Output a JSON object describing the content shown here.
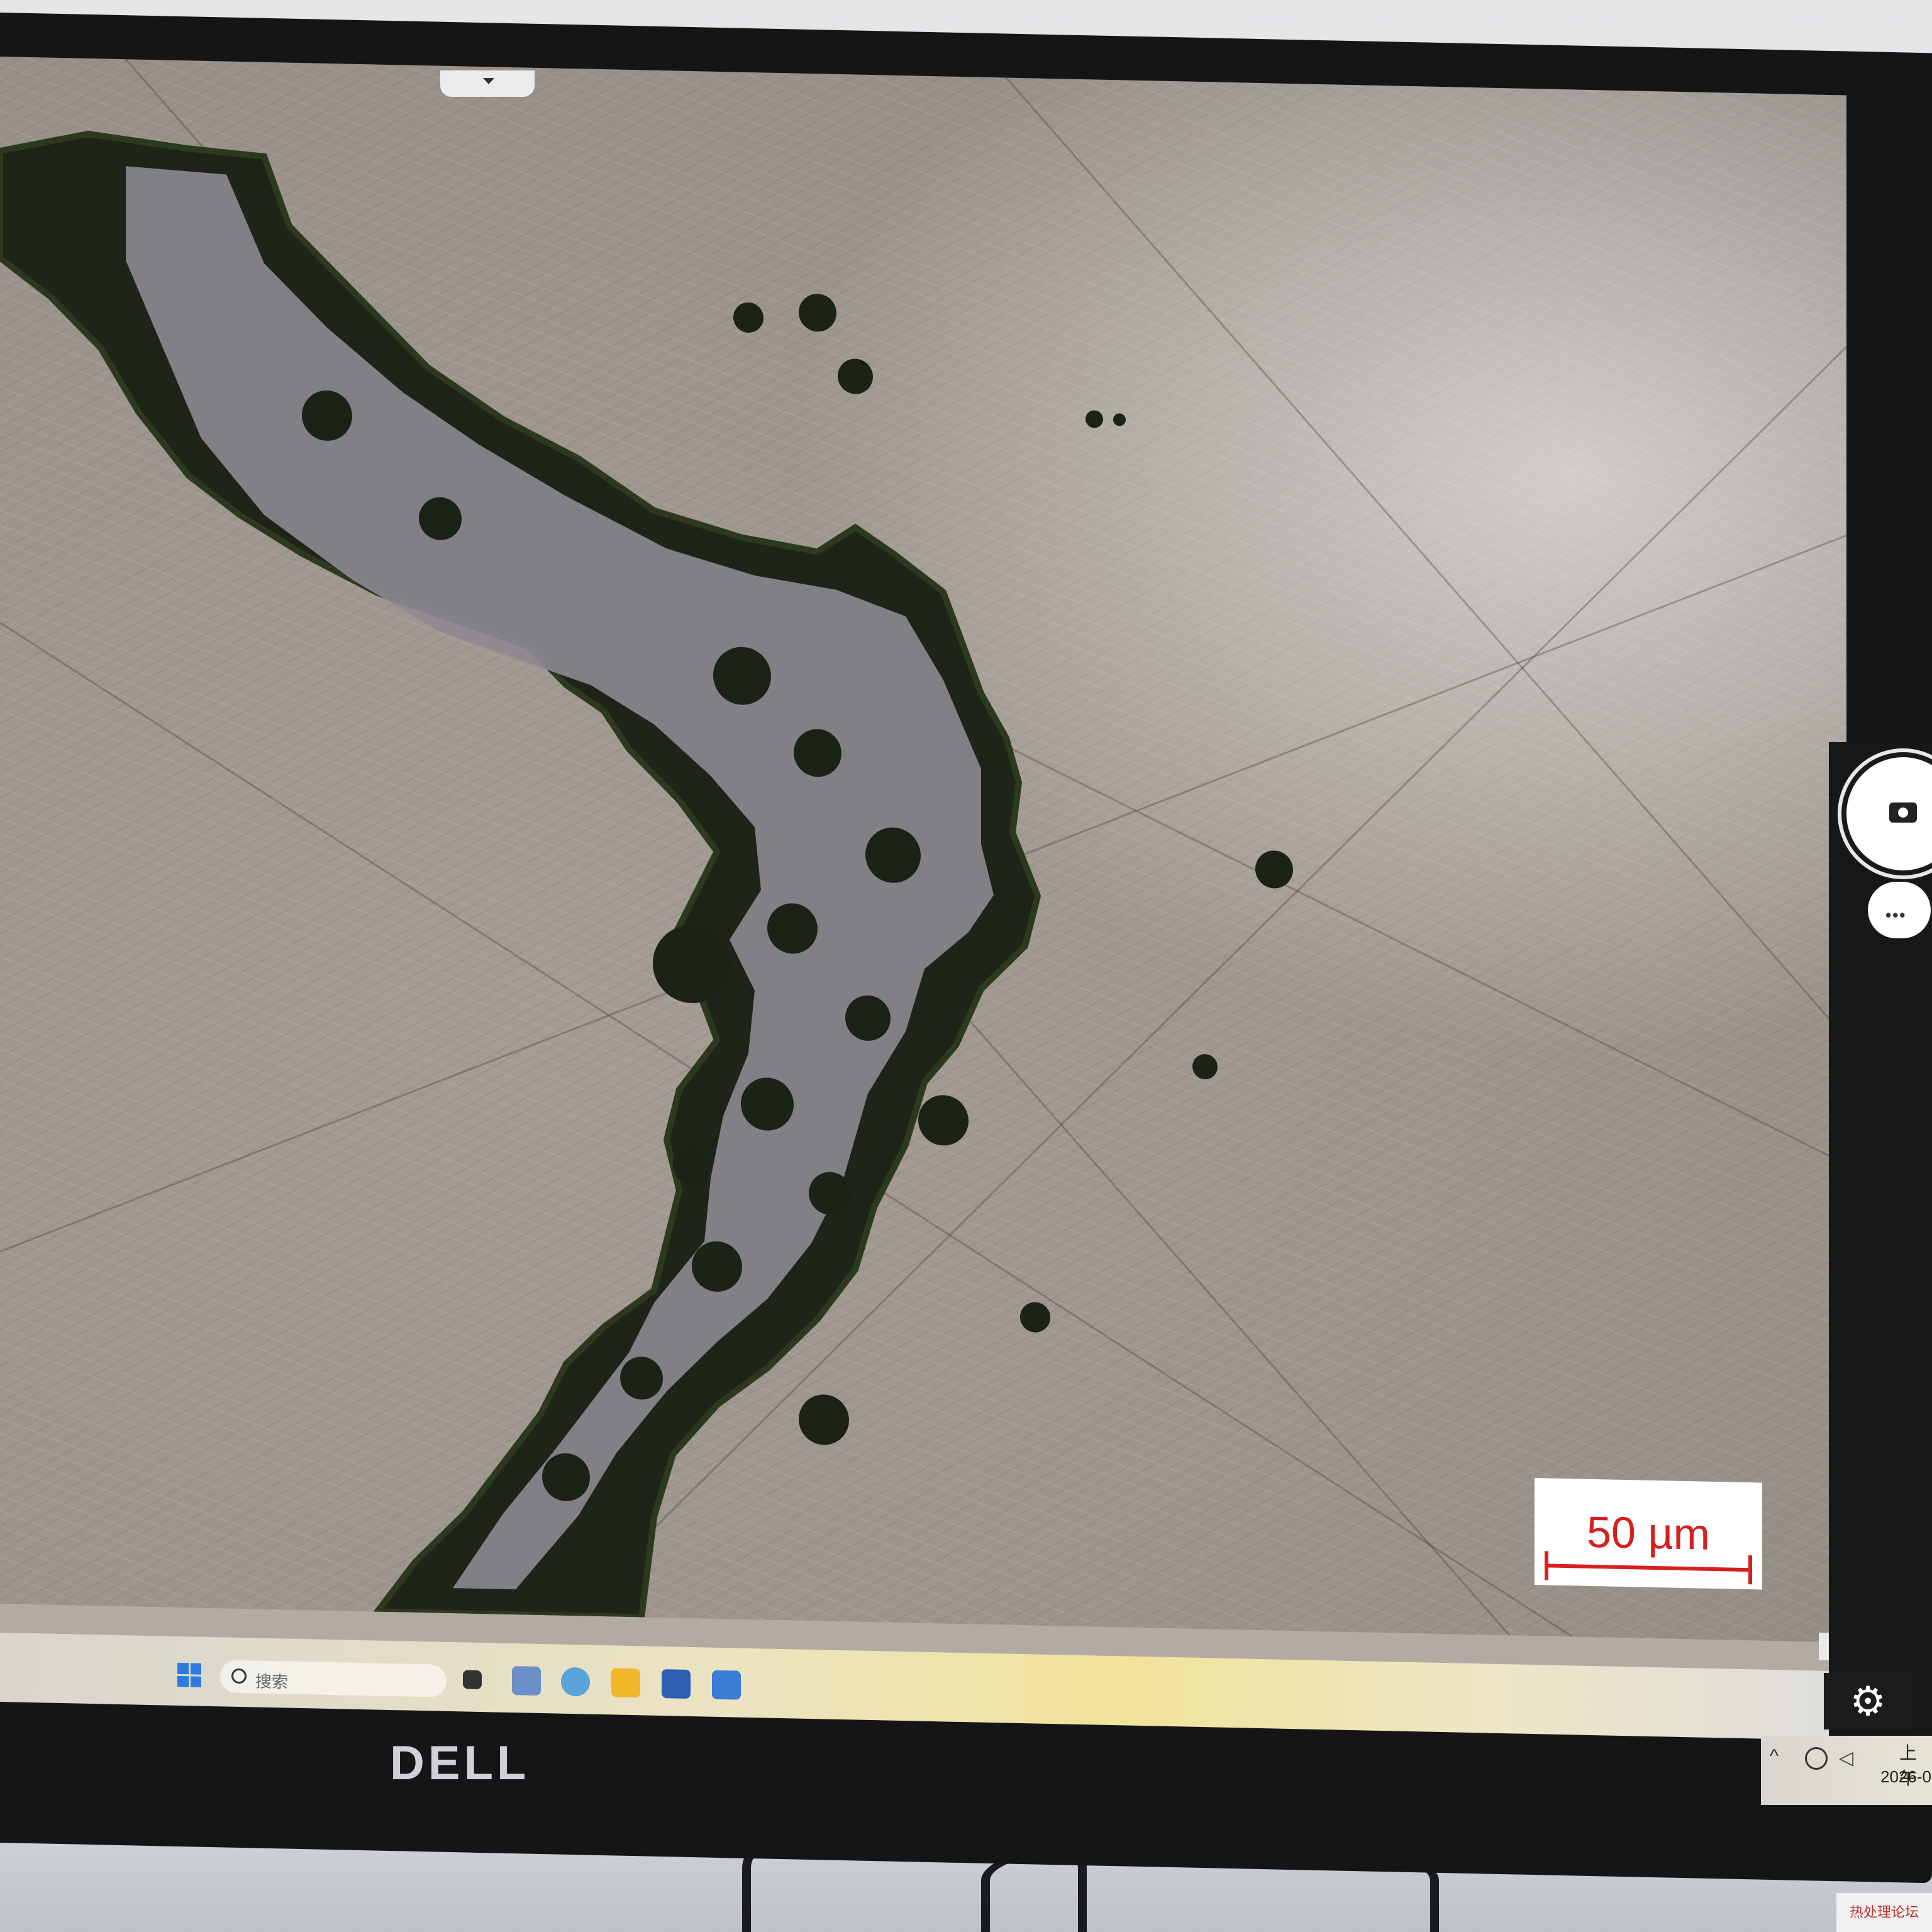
{
  "scale_bar": {
    "label": "50 µm"
  },
  "taskbar": {
    "search_placeholder": "搜索",
    "apps": [
      "file-manager-icon",
      "browser-icon",
      "folder-icon",
      "word-icon",
      "image-viewer-icon"
    ]
  },
  "tray": {
    "time_prefix": "上午",
    "date_prefix": "2026-0"
  },
  "ime": {
    "label": "拼"
  },
  "camera_panel": {
    "capture": "camera-icon",
    "more": "•••"
  },
  "monitor": {
    "brand": "DELL"
  },
  "watermark": {
    "text": "热处理论坛"
  },
  "colors": {
    "scale_red": "#d62020",
    "accent_blue": "#2d7be0"
  }
}
